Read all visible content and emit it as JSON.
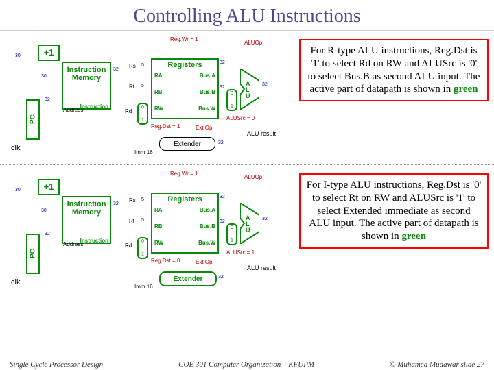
{
  "title": "Controlling ALU Instructions",
  "footer": {
    "left": "Single Cycle Processor Design",
    "center": "COE 301 Computer Organization – KFUPM",
    "right": "© Muhamed Mudawar slide 27"
  },
  "common": {
    "regwr": "Reg.Wr = 1",
    "aluop": "ALUOp",
    "plus1": "+1",
    "imem": "Instruction Memory",
    "imem_instr": "Instruction",
    "imem_addr": "Address",
    "pc": "PC",
    "registers": "Registers",
    "ports": {
      "ra": "RA",
      "rb": "RB",
      "rw": "RW",
      "busa": "Bus.A",
      "busb": "Bus.B",
      "busw": "Bus.W"
    },
    "rs": "Rs",
    "rt": "Rt",
    "rd": "Rd",
    "extender": "Extender",
    "extop": "Ext.Op",
    "imm16": "Imm 16",
    "alu": "A\nL\nU",
    "aluresult": "ALU result",
    "w30": "30",
    "w32": "32",
    "w5": "5",
    "clk": "clk",
    "mux0": "0",
    "mux1": "1"
  },
  "rtype": {
    "regdst": "Reg.Dst = 1",
    "alusrc": "ALUSrc = 0",
    "explain_pre": "For R-type ALU instructions, Reg.Dst is '1' to select Rd on RW and ALUSrc is '0' to select Bus.B as second ALU input. The active part of datapath is shown in ",
    "explain_green": "green"
  },
  "itype": {
    "regdst": "Reg.Dst = 0",
    "alusrc": "ALUSrc = 1",
    "explain_pre": "For I-type ALU instructions, Reg.Dst is '0' to select Rt on RW and ALUSrc is '1' to select Extended immediate as second ALU input. The active part of datapath is shown in ",
    "explain_green": "green"
  }
}
